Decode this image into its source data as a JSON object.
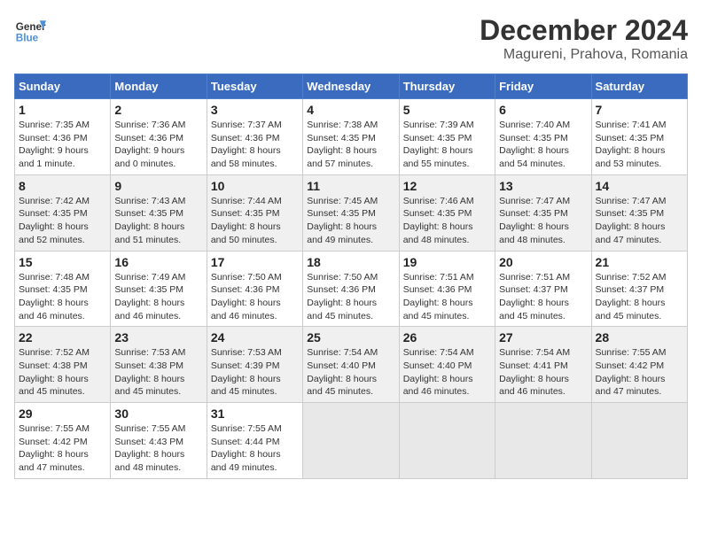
{
  "header": {
    "logo_line1": "General",
    "logo_line2": "Blue",
    "title": "December 2024",
    "subtitle": "Magureni, Prahova, Romania"
  },
  "weekdays": [
    "Sunday",
    "Monday",
    "Tuesday",
    "Wednesday",
    "Thursday",
    "Friday",
    "Saturday"
  ],
  "weeks": [
    [
      {
        "day": "1",
        "info": "Sunrise: 7:35 AM\nSunset: 4:36 PM\nDaylight: 9 hours\nand 1 minute."
      },
      {
        "day": "2",
        "info": "Sunrise: 7:36 AM\nSunset: 4:36 PM\nDaylight: 9 hours\nand 0 minutes."
      },
      {
        "day": "3",
        "info": "Sunrise: 7:37 AM\nSunset: 4:36 PM\nDaylight: 8 hours\nand 58 minutes."
      },
      {
        "day": "4",
        "info": "Sunrise: 7:38 AM\nSunset: 4:35 PM\nDaylight: 8 hours\nand 57 minutes."
      },
      {
        "day": "5",
        "info": "Sunrise: 7:39 AM\nSunset: 4:35 PM\nDaylight: 8 hours\nand 55 minutes."
      },
      {
        "day": "6",
        "info": "Sunrise: 7:40 AM\nSunset: 4:35 PM\nDaylight: 8 hours\nand 54 minutes."
      },
      {
        "day": "7",
        "info": "Sunrise: 7:41 AM\nSunset: 4:35 PM\nDaylight: 8 hours\nand 53 minutes."
      }
    ],
    [
      {
        "day": "8",
        "info": "Sunrise: 7:42 AM\nSunset: 4:35 PM\nDaylight: 8 hours\nand 52 minutes."
      },
      {
        "day": "9",
        "info": "Sunrise: 7:43 AM\nSunset: 4:35 PM\nDaylight: 8 hours\nand 51 minutes."
      },
      {
        "day": "10",
        "info": "Sunrise: 7:44 AM\nSunset: 4:35 PM\nDaylight: 8 hours\nand 50 minutes."
      },
      {
        "day": "11",
        "info": "Sunrise: 7:45 AM\nSunset: 4:35 PM\nDaylight: 8 hours\nand 49 minutes."
      },
      {
        "day": "12",
        "info": "Sunrise: 7:46 AM\nSunset: 4:35 PM\nDaylight: 8 hours\nand 48 minutes."
      },
      {
        "day": "13",
        "info": "Sunrise: 7:47 AM\nSunset: 4:35 PM\nDaylight: 8 hours\nand 48 minutes."
      },
      {
        "day": "14",
        "info": "Sunrise: 7:47 AM\nSunset: 4:35 PM\nDaylight: 8 hours\nand 47 minutes."
      }
    ],
    [
      {
        "day": "15",
        "info": "Sunrise: 7:48 AM\nSunset: 4:35 PM\nDaylight: 8 hours\nand 46 minutes."
      },
      {
        "day": "16",
        "info": "Sunrise: 7:49 AM\nSunset: 4:35 PM\nDaylight: 8 hours\nand 46 minutes."
      },
      {
        "day": "17",
        "info": "Sunrise: 7:50 AM\nSunset: 4:36 PM\nDaylight: 8 hours\nand 46 minutes."
      },
      {
        "day": "18",
        "info": "Sunrise: 7:50 AM\nSunset: 4:36 PM\nDaylight: 8 hours\nand 45 minutes."
      },
      {
        "day": "19",
        "info": "Sunrise: 7:51 AM\nSunset: 4:36 PM\nDaylight: 8 hours\nand 45 minutes."
      },
      {
        "day": "20",
        "info": "Sunrise: 7:51 AM\nSunset: 4:37 PM\nDaylight: 8 hours\nand 45 minutes."
      },
      {
        "day": "21",
        "info": "Sunrise: 7:52 AM\nSunset: 4:37 PM\nDaylight: 8 hours\nand 45 minutes."
      }
    ],
    [
      {
        "day": "22",
        "info": "Sunrise: 7:52 AM\nSunset: 4:38 PM\nDaylight: 8 hours\nand 45 minutes."
      },
      {
        "day": "23",
        "info": "Sunrise: 7:53 AM\nSunset: 4:38 PM\nDaylight: 8 hours\nand 45 minutes."
      },
      {
        "day": "24",
        "info": "Sunrise: 7:53 AM\nSunset: 4:39 PM\nDaylight: 8 hours\nand 45 minutes."
      },
      {
        "day": "25",
        "info": "Sunrise: 7:54 AM\nSunset: 4:40 PM\nDaylight: 8 hours\nand 45 minutes."
      },
      {
        "day": "26",
        "info": "Sunrise: 7:54 AM\nSunset: 4:40 PM\nDaylight: 8 hours\nand 46 minutes."
      },
      {
        "day": "27",
        "info": "Sunrise: 7:54 AM\nSunset: 4:41 PM\nDaylight: 8 hours\nand 46 minutes."
      },
      {
        "day": "28",
        "info": "Sunrise: 7:55 AM\nSunset: 4:42 PM\nDaylight: 8 hours\nand 47 minutes."
      }
    ],
    [
      {
        "day": "29",
        "info": "Sunrise: 7:55 AM\nSunset: 4:42 PM\nDaylight: 8 hours\nand 47 minutes."
      },
      {
        "day": "30",
        "info": "Sunrise: 7:55 AM\nSunset: 4:43 PM\nDaylight: 8 hours\nand 48 minutes."
      },
      {
        "day": "31",
        "info": "Sunrise: 7:55 AM\nSunset: 4:44 PM\nDaylight: 8 hours\nand 49 minutes."
      },
      null,
      null,
      null,
      null
    ]
  ]
}
